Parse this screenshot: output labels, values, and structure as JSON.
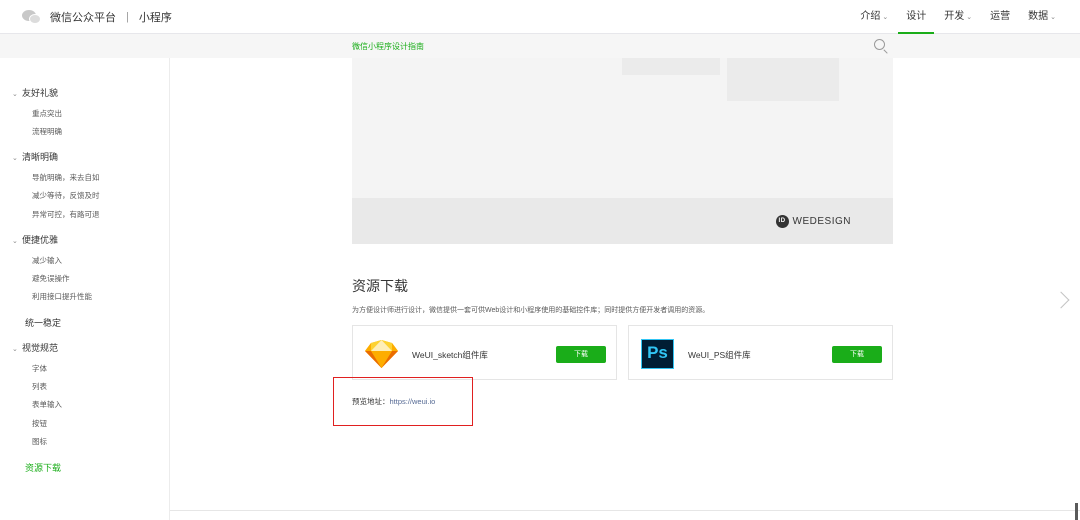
{
  "header": {
    "brand": "微信公众平台",
    "separator": "|",
    "product": "小程序",
    "nav": [
      {
        "label": "介绍",
        "dropdown": true,
        "active": false
      },
      {
        "label": "设计",
        "dropdown": false,
        "active": true
      },
      {
        "label": "开发",
        "dropdown": true,
        "active": false
      },
      {
        "label": "运营",
        "dropdown": false,
        "active": false
      },
      {
        "label": "数据",
        "dropdown": true,
        "active": false
      }
    ],
    "accent_color": "#1aad19"
  },
  "subbar": {
    "guide_title": "微信小程序设计指南",
    "search_icon": "search-icon"
  },
  "sidebar": {
    "groups": [
      {
        "label": "友好礼貌",
        "items": [
          "重点突出",
          "流程明确"
        ]
      },
      {
        "label": "清晰明确",
        "items": [
          "导航明确，来去自如",
          "减少等待，反馈及时",
          "异常可控，有路可退"
        ]
      },
      {
        "label": "便捷优雅",
        "items": [
          "减少输入",
          "避免误操作",
          "利用接口提升性能"
        ]
      },
      {
        "label": "统一稳定"
      },
      {
        "label": "视觉规范",
        "items": [
          "字体",
          "列表",
          "表单输入",
          "按钮",
          "图标"
        ]
      },
      {
        "label": "资源下载",
        "active": true
      }
    ]
  },
  "content": {
    "banner_brand": "WEDESIGN",
    "resources_title": "资源下载",
    "resources_desc": "为方便设计师进行设计，微信提供一套可供Web设计和小程序使用的基础控件库；同时提供方便开发者调用的资源。",
    "cards": [
      {
        "name": "WeUI_sketch组件库",
        "icon": "sketch-icon",
        "button": "下载"
      },
      {
        "name": "WeUI_PS组件库",
        "icon": "photoshop-icon",
        "icon_text": "Ps",
        "button": "下载"
      }
    ],
    "preview_label": "预览地址：",
    "preview_url": "https://weui.io"
  }
}
